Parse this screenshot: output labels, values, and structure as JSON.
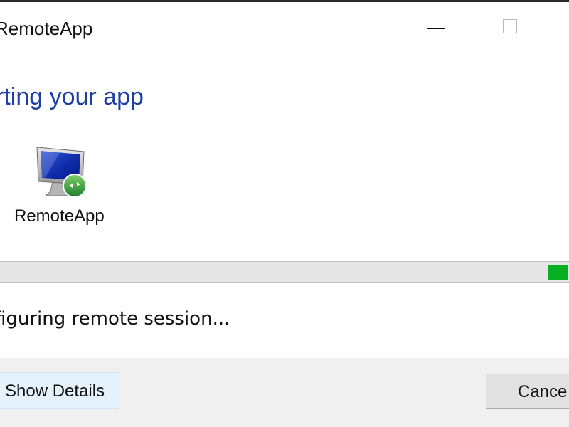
{
  "window": {
    "title": "RemoteApp",
    "controls": {
      "minimize_icon": "minimize-icon",
      "maximize_icon": "maximize-icon"
    }
  },
  "main": {
    "heading": "rting your app",
    "app": {
      "icon": "remote-desktop-computer-icon",
      "label": "RemoteApp"
    },
    "progress": {
      "mode": "marquee",
      "chunk_color": "#06b025"
    },
    "status": "figuring remote session..."
  },
  "footer": {
    "details_label": "Show Details",
    "cancel_label": "Cance"
  },
  "colors": {
    "heading": "#1d3fa5",
    "progress": "#06b025",
    "details_hover_bg": "#e5f1fb"
  }
}
